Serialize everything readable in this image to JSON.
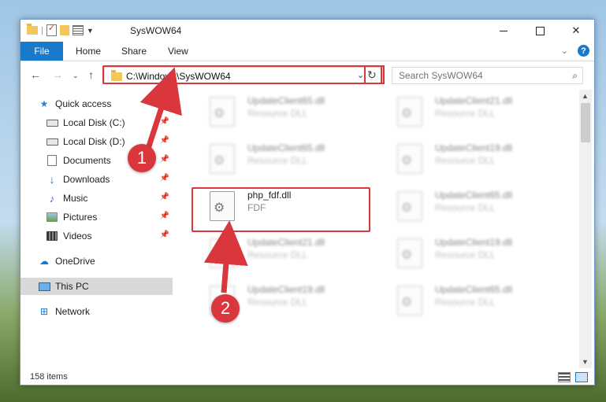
{
  "window": {
    "title": "SysWOW64"
  },
  "ribbon": {
    "tabs": [
      "File",
      "Home",
      "Share",
      "View"
    ]
  },
  "address": {
    "path": "C:\\Windows\\SysWOW64"
  },
  "search": {
    "placeholder": "Search SysWOW64"
  },
  "sidebar": {
    "items": [
      {
        "label": "Quick access",
        "icon": "star-icon"
      },
      {
        "label": "Local Disk (C:)",
        "icon": "drive-icon",
        "pinned": true
      },
      {
        "label": "Local Disk (D:)",
        "icon": "drive-icon",
        "pinned": true
      },
      {
        "label": "Documents",
        "icon": "document-icon",
        "pinned": true
      },
      {
        "label": "Downloads",
        "icon": "download-icon",
        "pinned": true
      },
      {
        "label": "Music",
        "icon": "music-icon",
        "pinned": true
      },
      {
        "label": "Pictures",
        "icon": "pictures-icon",
        "pinned": true
      },
      {
        "label": "Videos",
        "icon": "video-icon",
        "pinned": true
      },
      {
        "label": "OneDrive",
        "icon": "cloud-icon"
      },
      {
        "label": "This PC",
        "icon": "computer-icon",
        "selected": true
      },
      {
        "label": "Network",
        "icon": "network-icon"
      }
    ]
  },
  "files": [
    {
      "name": "UpdateClient65.dll",
      "type": "Resource DLL"
    },
    {
      "name": "UpdateClient21.dll",
      "type": "Resource DLL"
    },
    {
      "name": "UpdateClient65.dll",
      "type": "Resource DLL"
    },
    {
      "name": "UpdateClient19.dll",
      "type": "Resource DLL"
    },
    {
      "name": "php_fdf.dll",
      "type": "FDF",
      "highlighted": true
    },
    {
      "name": "UpdateClient65.dll",
      "type": "Resource DLL"
    },
    {
      "name": "UpdateClient21.dll",
      "type": "Resource DLL"
    },
    {
      "name": "UpdateClient19.dll",
      "type": "Resource DLL"
    },
    {
      "name": "UpdateClient19.dll",
      "type": "Resource DLL"
    },
    {
      "name": "UpdateClient65.dll",
      "type": "Resource DLL"
    }
  ],
  "status": {
    "item_count": "158 items"
  },
  "callouts": {
    "first": "1",
    "second": "2"
  },
  "colors": {
    "accent": "#1979ca",
    "highlight": "#d9363e",
    "selected": "#d9d9d9"
  }
}
